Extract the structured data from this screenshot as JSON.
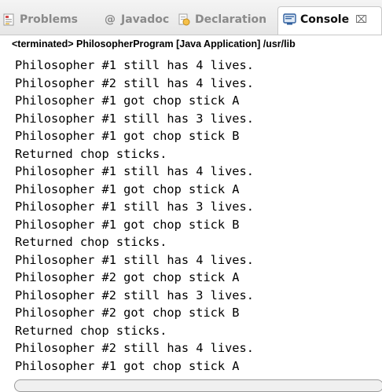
{
  "tabs": [
    {
      "label": "Problems",
      "icon": "problems-icon"
    },
    {
      "label": "Javadoc",
      "icon": "javadoc-icon"
    },
    {
      "label": "Declaration",
      "icon": "declaration-icon"
    },
    {
      "label": "Console",
      "icon": "console-icon",
      "active": true,
      "close": "⌧"
    }
  ],
  "status": "<terminated> PhilosopherProgram [Java Application] /usr/lib",
  "console_lines": [
    "Philosopher #1 still has 4 lives.",
    "Philosopher #2 still has 4 lives.",
    "Philosopher #1 got chop stick A",
    "Philosopher #1 still has 3 lives.",
    "Philosopher #1 got chop stick B",
    "Returned chop sticks.",
    "Philosopher #1 still has 4 lives.",
    "Philosopher #1 got chop stick A",
    "Philosopher #1 still has 3 lives.",
    "Philosopher #1 got chop stick B",
    "Returned chop sticks.",
    "Philosopher #1 still has 4 lives.",
    "Philosopher #2 got chop stick A",
    "Philosopher #2 still has 3 lives.",
    "Philosopher #2 got chop stick B",
    "Returned chop sticks.",
    "Philosopher #2 still has 4 lives.",
    "Philosopher #1 got chop stick A"
  ],
  "colors": {
    "tabbar_top": "#f4f4f4",
    "tabbar_bottom": "#e6e6e6",
    "inactive_tab_text": "#8a8a8a",
    "active_tab_text": "#111111",
    "console_text": "#000000",
    "console_icon": "#2f5f9e"
  }
}
